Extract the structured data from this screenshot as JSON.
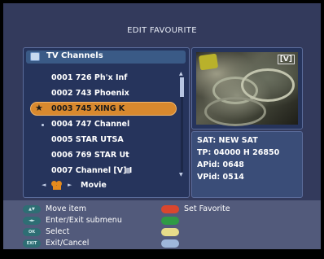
{
  "screen_title": "EDIT FAVOURITE",
  "list_panel": {
    "header_label": "TV Channels",
    "channels": [
      {
        "label": "0001 726 Ph'x Inf"
      },
      {
        "label": "0002 743 Phoenix"
      },
      {
        "label": "0003 745 XING K"
      },
      {
        "label": "0004 747 Channel"
      },
      {
        "label": "0005 STAR UTSA"
      },
      {
        "label": "0006 769 STAR Ut"
      },
      {
        "label": "0007 Channel [V] I"
      }
    ],
    "selected_index": 2,
    "group_label": "Movie"
  },
  "preview": {
    "badge": "[V]"
  },
  "info": {
    "sat": "SAT: NEW SAT",
    "tp": "TP: 04000 H 26850",
    "apid": "APid: 0648",
    "vpid": "VPid: 0514"
  },
  "help": {
    "left": [
      {
        "key": "▲▼",
        "text": "Move item"
      },
      {
        "key": "◄►",
        "text": "Enter/Exit submenu"
      },
      {
        "key": "OK",
        "text": "Select"
      },
      {
        "key": "EXIT",
        "text": "Exit/Cancel"
      }
    ],
    "right": [
      {
        "color": "#d9462e",
        "text": "Set Favorite"
      },
      {
        "color": "#2f9a45",
        "text": ""
      },
      {
        "color": "#e6dc8a",
        "text": ""
      },
      {
        "color": "#9fb7db",
        "text": ""
      }
    ]
  },
  "colors": {
    "background": "#333a5c",
    "highlight": "#d9892e",
    "panel": "#26345c"
  }
}
